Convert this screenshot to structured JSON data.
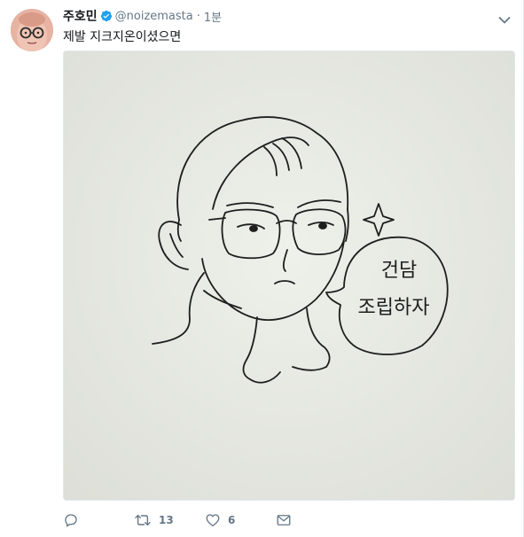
{
  "tweet": {
    "display_name": "주호민",
    "handle": "@noizemasta",
    "separator": "·",
    "time": "1분",
    "text": "제발 지크지온이셨으면",
    "verified": true
  },
  "drawing": {
    "speech_line1": "건담",
    "speech_line2": "조립하자"
  },
  "actions": {
    "reply_icon": "reply-icon",
    "retweet_icon": "retweet-icon",
    "retweet_count": "13",
    "like_icon": "heart-icon",
    "like_count": "6",
    "dm_icon": "envelope-icon"
  },
  "colors": {
    "verified": "#1da1f2",
    "muted": "#657786",
    "paper": "#e8e9e3"
  }
}
